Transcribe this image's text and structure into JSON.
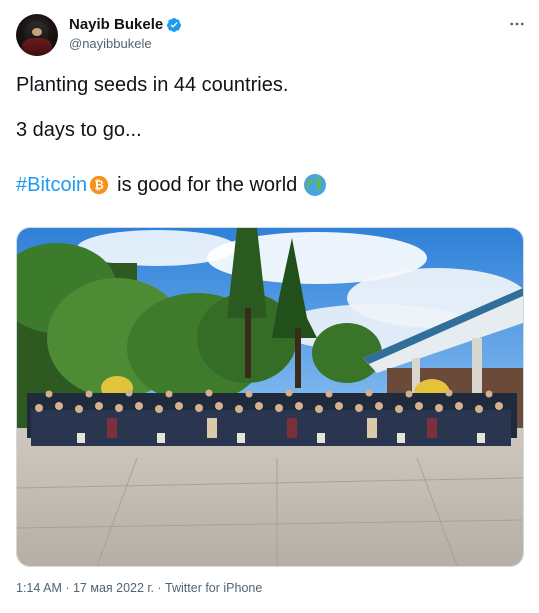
{
  "author": {
    "name": "Nayib Bukele",
    "handle": "@nayibbukele",
    "verified": true
  },
  "tweet": {
    "line1": "Planting seeds in 44 countries.",
    "line2": "3 days to go...",
    "hashtag": "#Bitcoin",
    "line3_rest": "is good for the world",
    "emoji_after_hashtag": "bitcoin-icon",
    "emoji_end": "globe-icon"
  },
  "photo": {
    "subject": "group-photo"
  },
  "meta": {
    "time": "1:14 AM",
    "date": "17 мая 2022 г.",
    "separator": " · ",
    "source": "Twitter for iPhone"
  },
  "colors": {
    "accent": "#1d9bf0",
    "text": "#0f1419",
    "muted": "#536471",
    "bitcoin": "#f7931a"
  }
}
